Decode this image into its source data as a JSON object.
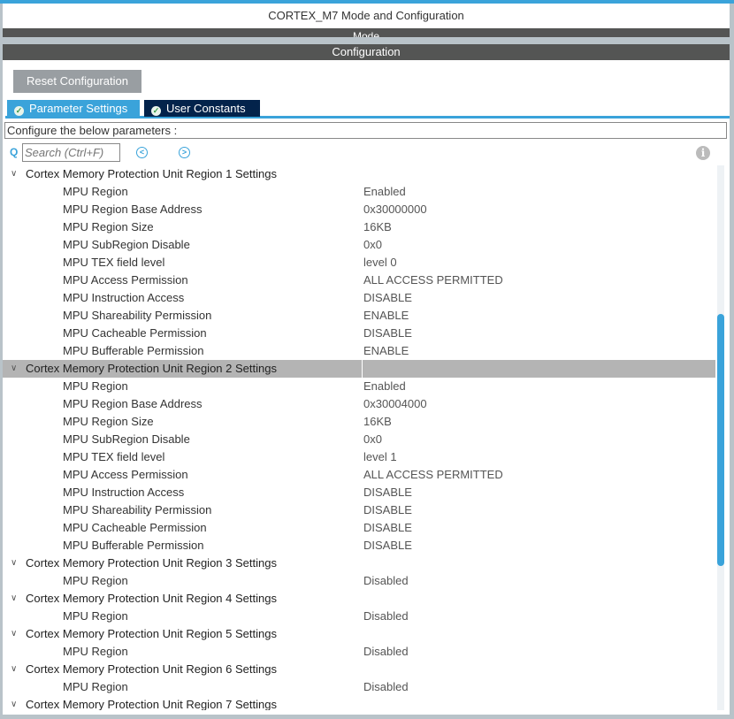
{
  "window_title": "CORTEX_M7 Mode and Configuration",
  "mode_label": "Mode",
  "config_label": "Configuration",
  "reset_button": "Reset Configuration",
  "tabs": [
    {
      "label": "Parameter Settings",
      "active": true
    },
    {
      "label": "User Constants",
      "active": false
    }
  ],
  "description": "Configure the below parameters :",
  "search_placeholder": "Search (Ctrl+F)",
  "groups": [
    {
      "label": "Cortex Memory Protection Unit Region 1 Settings",
      "selected": false,
      "params": [
        [
          "MPU Region",
          "Enabled"
        ],
        [
          "MPU Region Base Address",
          "0x30000000"
        ],
        [
          "MPU Region Size",
          "16KB"
        ],
        [
          "MPU SubRegion Disable",
          "0x0"
        ],
        [
          "MPU TEX field level",
          "level 0"
        ],
        [
          "MPU Access Permission",
          "ALL ACCESS PERMITTED"
        ],
        [
          "MPU Instruction Access",
          "DISABLE"
        ],
        [
          "MPU Shareability Permission",
          "ENABLE"
        ],
        [
          "MPU Cacheable Permission",
          "DISABLE"
        ],
        [
          "MPU Bufferable  Permission",
          "ENABLE"
        ]
      ]
    },
    {
      "label": "Cortex Memory Protection Unit Region 2 Settings",
      "selected": true,
      "params": [
        [
          "MPU Region",
          "Enabled"
        ],
        [
          "MPU Region Base Address",
          "0x30004000"
        ],
        [
          "MPU Region Size",
          "16KB"
        ],
        [
          "MPU SubRegion Disable",
          "0x0"
        ],
        [
          "MPU TEX field level",
          "level 1"
        ],
        [
          "MPU Access Permission",
          "ALL ACCESS PERMITTED"
        ],
        [
          "MPU Instruction Access",
          "DISABLE"
        ],
        [
          "MPU Shareability Permission",
          "DISABLE"
        ],
        [
          "MPU Cacheable Permission",
          "DISABLE"
        ],
        [
          "MPU Bufferable  Permission",
          "DISABLE"
        ]
      ]
    },
    {
      "label": "Cortex Memory Protection Unit Region 3 Settings",
      "selected": false,
      "params": [
        [
          "MPU Region",
          "Disabled"
        ]
      ]
    },
    {
      "label": "Cortex Memory Protection Unit Region 4 Settings",
      "selected": false,
      "params": [
        [
          "MPU Region",
          "Disabled"
        ]
      ]
    },
    {
      "label": "Cortex Memory Protection Unit Region 5 Settings",
      "selected": false,
      "params": [
        [
          "MPU Region",
          "Disabled"
        ]
      ]
    },
    {
      "label": "Cortex Memory Protection Unit Region 6 Settings",
      "selected": false,
      "params": [
        [
          "MPU Region",
          "Disabled"
        ]
      ]
    },
    {
      "label": "Cortex Memory Protection Unit Region 7 Settings",
      "selected": false,
      "params": []
    }
  ]
}
